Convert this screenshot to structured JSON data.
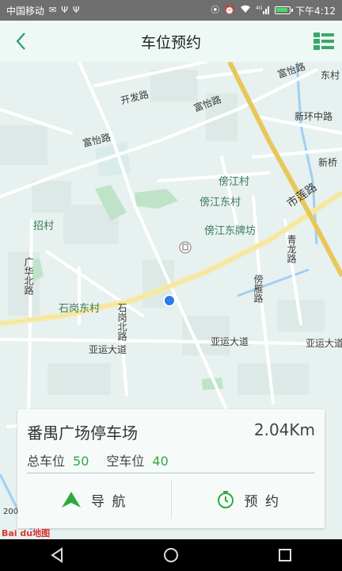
{
  "status_bar": {
    "carrier": "中国移动",
    "time": "下午4:12",
    "network": "4G"
  },
  "header": {
    "title": "车位预约",
    "back_icon": "back-arrow-icon",
    "menu_icon": "list-grid-icon"
  },
  "map": {
    "labels": {
      "fuyi_1": "富怡路",
      "fuyi_2": "富怡路",
      "fuyi_3": "富怡路",
      "dongcun": "东村",
      "kaifa": "开发路",
      "xinhuanzhong": "新环中路",
      "xinqiao": "新桥",
      "bangjiang": "傍江村",
      "bangjiangdong": "傍江东村",
      "bangjiangdongpai": "傍江东牌坊",
      "shilian": "市莲路",
      "zhaocun": "招村",
      "guanghuabei": "广华北路",
      "qinglong": "青龙路",
      "bangyan": "傍雁路",
      "shigangdong": "石岗东村",
      "shigangbei": "石岗北路",
      "yayun_1": "亚运大道",
      "yayun_2": "亚运大道",
      "yayun_3": "亚运大道"
    },
    "scale": "200",
    "logo": "Bai du地图"
  },
  "card": {
    "name": "番禺广场停车场",
    "distance": "2.04Km",
    "total_label": "总车位",
    "total_value": "50",
    "empty_label": "空车位",
    "empty_value": "40",
    "navigate_label": "导 航",
    "reserve_label": "预 约"
  },
  "colors": {
    "accent_green": "#2eaa3c",
    "header_bg": "#eef8f5",
    "highway": "#e8c75a",
    "location_dot": "#2b7de9"
  }
}
